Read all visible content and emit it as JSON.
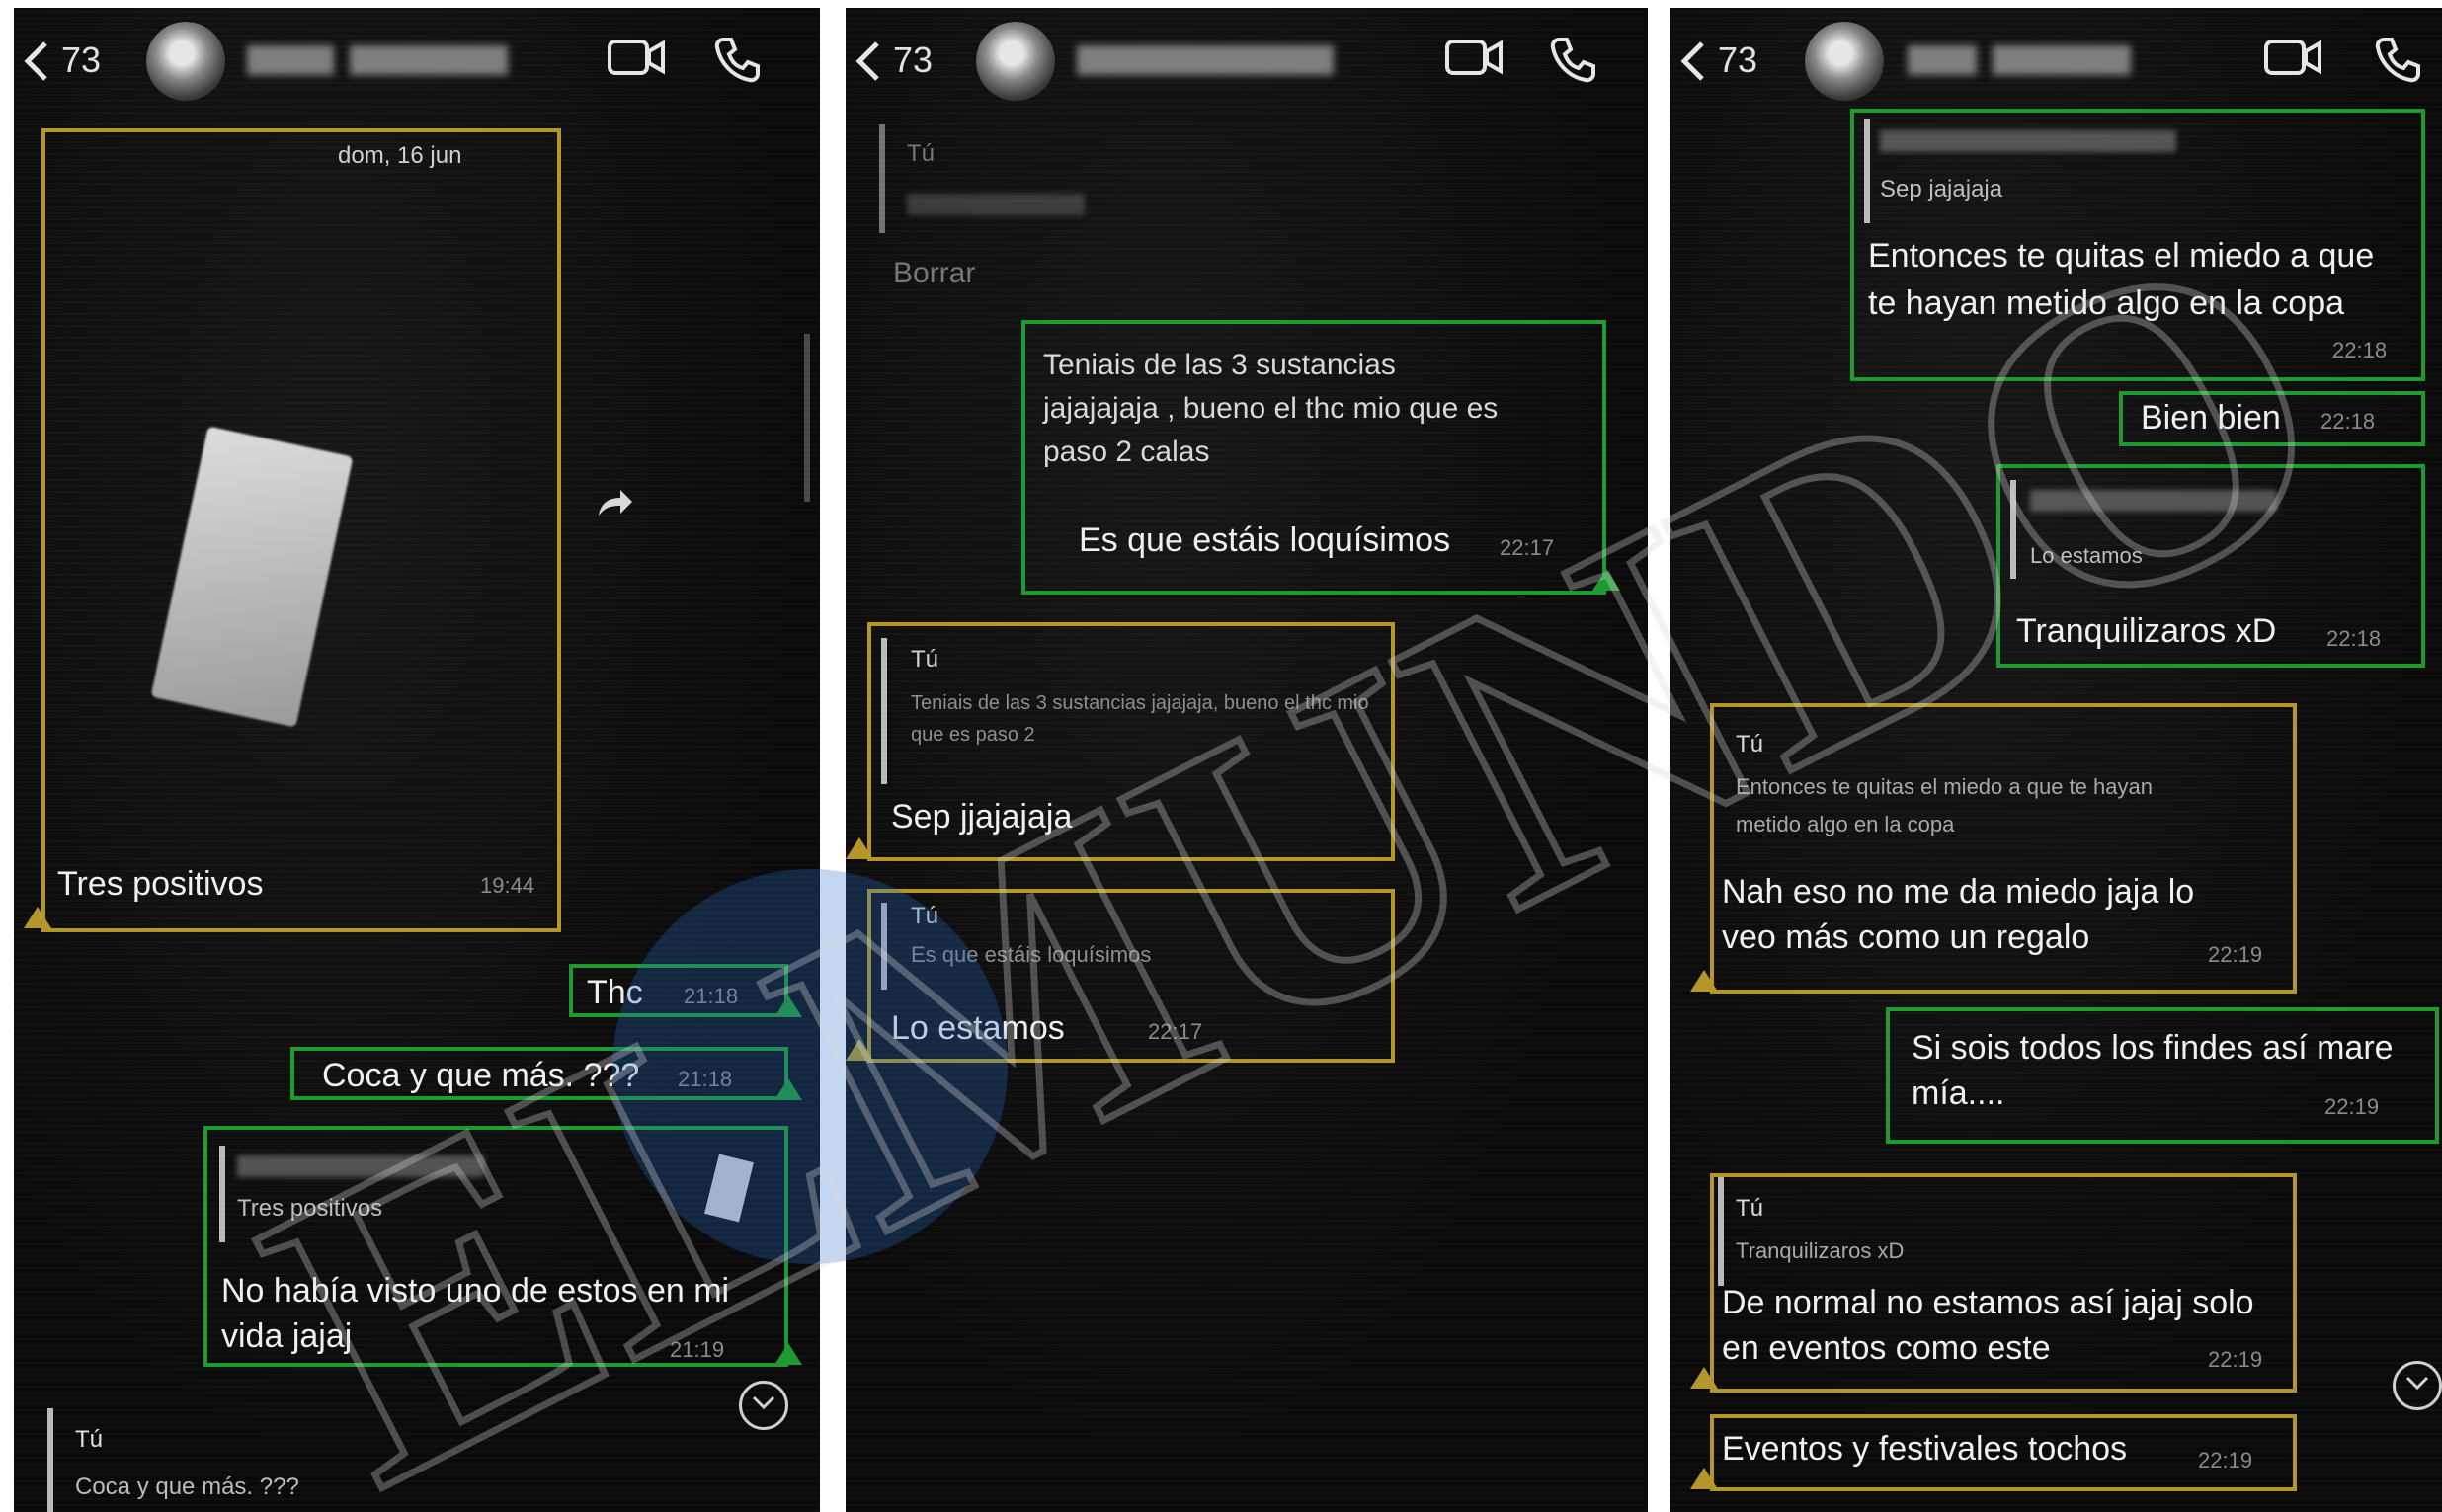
{
  "header": {
    "unread_count": "73"
  },
  "panel1": {
    "date_label": "dom, 16 jun",
    "image_caption": "Tres positivos",
    "image_time": "19:44",
    "msg_thc": "Thc",
    "msg_thc_time": "21:18",
    "msg_coca": "Coca y que más. ???",
    "msg_coca_time": "21:18",
    "reply_quote": "Tres positivos",
    "reply_text": "No había visto uno de estos en mi vida jajaj",
    "reply_time": "21:19",
    "bottom_sender": "Tú",
    "bottom_quote": "Coca y que más. ???"
  },
  "panel2": {
    "top_sender": "Tú",
    "top_deleted": "Borrar",
    "msg1_line1": "Teniais de las 3 sustancias",
    "msg1_line2": "jajajajaja , bueno el thc mio que es",
    "msg1_line3": "paso 2 calas",
    "msg1_line4": "Es que estáis loquísimos",
    "msg1_time": "22:17",
    "reply1_sender": "Tú",
    "reply1_quote": "Teniais de las 3 sustancias jajajaja, bueno el thc mio que es paso 2",
    "reply1_text": "Sep jjajajaja",
    "reply2_sender": "Tú",
    "reply2_quote": "Es que estáis loquísimos",
    "reply2_text": "Lo estamos",
    "reply2_time": "22:17"
  },
  "panel3": {
    "m1_quote": "Sep jajajaja",
    "m1_line1": "Entonces te quitas el miedo a que",
    "m1_line2": "te hayan metido algo en la copa",
    "m1_time": "22:18",
    "m2_text": "Bien bien",
    "m2_time": "22:18",
    "m3_quote": "Lo estamos",
    "m3_text": "Tranquilizaros xD",
    "m3_time": "22:18",
    "r1_sender": "Tú",
    "r1_quote_line1": "Entonces te quitas el miedo a que te hayan",
    "r1_quote_line2": "metido algo en la copa",
    "r1_line1": "Nah eso no me da miedo jaja lo",
    "r1_line2": "veo más como un regalo",
    "r1_time": "22:19",
    "m4_line1": "Si sois todos los findes así mare",
    "m4_line2": "mía....",
    "m4_time": "22:19",
    "r2_sender": "Tú",
    "r2_quote": "Tranquilizaros xD",
    "r2_line1": "De normal no estamos así jajaj solo",
    "r2_line2": "en eventos como este",
    "r2_time": "22:19",
    "r3_text": "Eventos y festivales tochos",
    "r3_time": "22:19"
  },
  "watermark": {
    "text": "ELMUNDO"
  },
  "colors": {
    "sent_border": "#1e9a30",
    "received_border": "#b4962a",
    "background": "#0b0b0b"
  },
  "icons": [
    "chevron-left-icon",
    "video-call-icon",
    "phone-icon",
    "forward-icon",
    "scroll-down-icon",
    "double-check-icon"
  ]
}
